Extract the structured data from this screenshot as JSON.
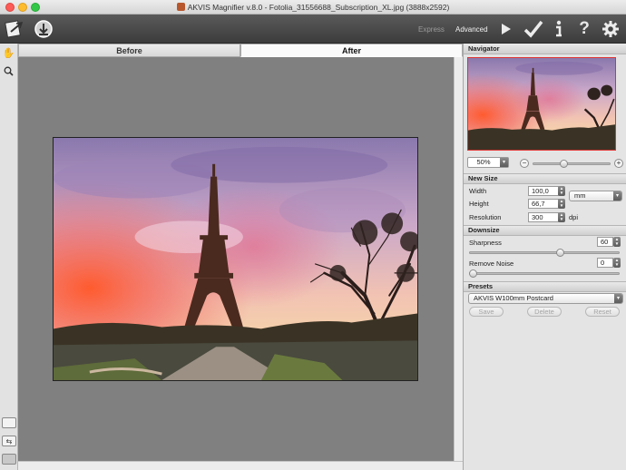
{
  "window": {
    "title": "AKVIS Magnifier v.8.0 - Fotolia_31556688_Subscription_XL.jpg (3888x2592)"
  },
  "toolbar": {
    "modes": {
      "express": "Express",
      "advanced": "Advanced"
    },
    "icons": [
      "open-image-icon",
      "save-image-icon",
      "run-icon",
      "apply-icon",
      "info-icon",
      "help-icon",
      "preferences-icon"
    ]
  },
  "tools": [
    "hand-icon",
    "zoom-icon"
  ],
  "tabs": {
    "before": "Before",
    "after": "After"
  },
  "navigator": {
    "title": "Navigator",
    "zoom": "50%",
    "zoom_out": "−",
    "zoom_in": "+"
  },
  "new_size": {
    "title": "New Size",
    "width_label": "Width",
    "width_value": "100,0",
    "height_label": "Height",
    "height_value": "66,7",
    "resolution_label": "Resolution",
    "resolution_value": "300",
    "resolution_unit": "dpi",
    "unit": "mm"
  },
  "downsize": {
    "title": "Downsize",
    "sharpness_label": "Sharpness",
    "sharpness_value": "60",
    "sharpness_level": 60,
    "noise_label": "Remove Noise",
    "noise_value": "0",
    "noise_level": 0
  },
  "presets": {
    "title": "Presets",
    "selected": "AKVIS W100mm Postcard",
    "save": "Save",
    "delete": "Delete",
    "reset": "Reset"
  },
  "colors": {
    "toolbar_bg": "#4a4a4a",
    "canvas_bg": "#808080",
    "panel_bg": "#e4e4e4",
    "nav_frame": "#dd3333"
  }
}
